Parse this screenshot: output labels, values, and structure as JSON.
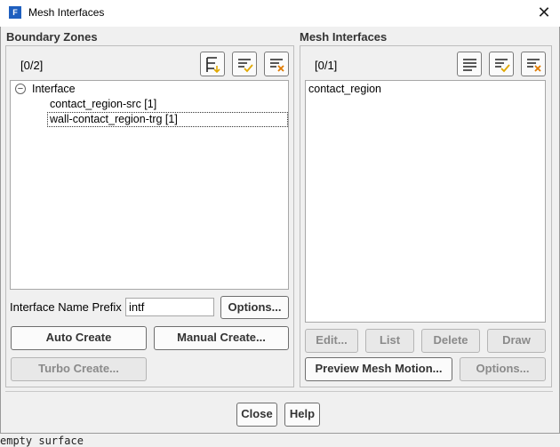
{
  "window": {
    "title": "Mesh Interfaces",
    "close_glyph": "✕"
  },
  "boundary_zones": {
    "title": "Boundary Zones",
    "count": "[0/2]",
    "tree": {
      "group_label": "Interface",
      "toggle": "−",
      "items": [
        {
          "label": "contact_region-src  [1]"
        },
        {
          "label": "wall-contact_region-trg  [1]"
        }
      ]
    },
    "prefix_label": "Interface Name Prefix",
    "prefix_value": "intf",
    "options_button": "Options...",
    "auto_create_button": "Auto Create",
    "manual_create_button": "Manual Create...",
    "turbo_create_button": "Turbo Create..."
  },
  "mesh_interfaces": {
    "title": "Mesh Interfaces",
    "count": "[0/1]",
    "items": [
      {
        "label": "contact_region"
      }
    ],
    "edit_button": "Edit...",
    "list_button": "List",
    "delete_button": "Delete",
    "draw_button": "Draw",
    "preview_button": "Preview Mesh Motion...",
    "options_button": "Options..."
  },
  "footer": {
    "close_button": "Close",
    "help_button": "Help"
  },
  "background_text": "empty surface",
  "colors": {
    "app_icon": "#1e5fbf",
    "check_yellow": "#e0a800",
    "x_orange": "#e07a00"
  }
}
